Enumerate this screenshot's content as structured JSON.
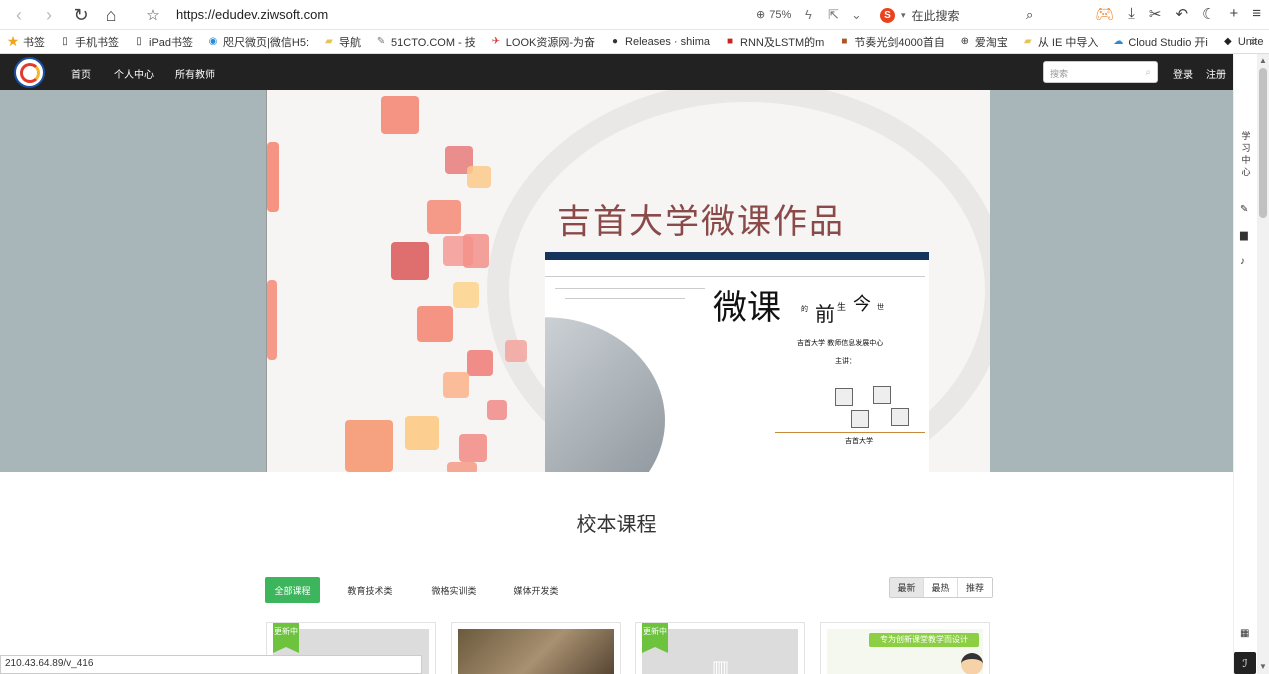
{
  "browser": {
    "url": "https://edudev.ziwsoft.com",
    "zoom": "75%",
    "search_placeholder": "在此搜索",
    "search_engine_letter": "S"
  },
  "bookmarks": [
    {
      "label": "书签",
      "icon": "star-icon"
    },
    {
      "label": "手机书签",
      "icon": "phone-icon"
    },
    {
      "label": "iPad书签",
      "icon": "tablet-icon"
    },
    {
      "label": "咫尺微页|微信H5:",
      "icon": "site-icon"
    },
    {
      "label": "导航",
      "icon": "folder-icon"
    },
    {
      "label": "51CTO.COM - 技",
      "icon": "site-icon"
    },
    {
      "label": "LOOK资源网-为奋",
      "icon": "site-icon"
    },
    {
      "label": "Releases · shima",
      "icon": "github-icon"
    },
    {
      "label": "RNN及LSTM的m",
      "icon": "site-icon"
    },
    {
      "label": "节奏光剑4000首自",
      "icon": "site-icon"
    },
    {
      "label": "爱淘宝",
      "icon": "globe-icon"
    },
    {
      "label": "从 IE 中导入",
      "icon": "folder-icon"
    },
    {
      "label": "Cloud Studio 开i",
      "icon": "cloud-icon"
    },
    {
      "label": "Unite",
      "icon": "unity-icon"
    }
  ],
  "site_nav": {
    "links": [
      "首页",
      "个人中心",
      "所有教师"
    ],
    "search_placeholder": "搜索",
    "login": "登录",
    "register": "注册"
  },
  "banner": {
    "title": "吉首大学微课作品",
    "calligraphy_main": "微课",
    "calligraphy_sub1": "前",
    "calligraphy_sub2": "今",
    "calligraphy_small1": "的",
    "calligraphy_small2": "生",
    "calligraphy_small3": "世",
    "credit_line": "吉首大学 教师信息发展中心",
    "presenter": "主讲：",
    "footer_mark": "吉首大学"
  },
  "section": {
    "title": "校本课程"
  },
  "filters": [
    "全部课程",
    "教育技术类",
    "微格实训类",
    "媒体开发类"
  ],
  "sort": [
    "最新",
    "最热",
    "推荐"
  ],
  "cards": [
    {
      "ribbon": "更新中"
    },
    {
      "ribbon": ""
    },
    {
      "ribbon": "更新中"
    },
    {
      "ribbon": "",
      "caption": "专为创新课堂教学而设计"
    }
  ],
  "status_bar": "210.43.64.89/v_416",
  "right_panel": {
    "label": "学习中心"
  },
  "colors": {
    "nav_bg": "#222222",
    "accent_green": "#3cb55d",
    "banner_side": "#a8b5b9"
  }
}
